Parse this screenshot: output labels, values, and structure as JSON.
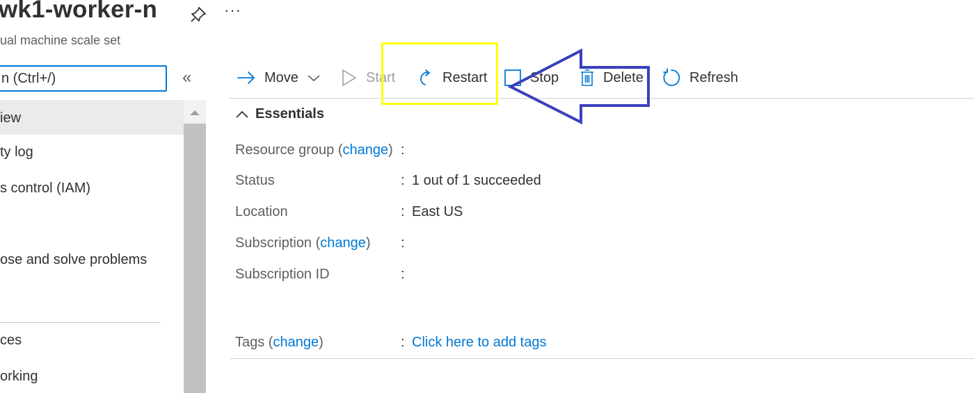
{
  "header": {
    "title": "wk1-worker-n",
    "subtitle": "ual machine scale set",
    "more_label": "···"
  },
  "search": {
    "value": "n (Ctrl+/)"
  },
  "sidebar": {
    "collapse_label": "«",
    "items": [
      {
        "label": "iew",
        "active": true
      },
      {
        "label": "ty log"
      },
      {
        "label": "s control (IAM)"
      },
      {
        "label": "ose and solve problems"
      },
      {
        "label": "ces"
      },
      {
        "label": "orking"
      }
    ]
  },
  "toolbar": {
    "move_label": "Move",
    "start_label": "Start",
    "restart_label": "Restart",
    "stop_label": "Stop",
    "delete_label": "Delete",
    "refresh_label": "Refresh"
  },
  "essentials": {
    "heading": "Essentials",
    "rows": [
      {
        "label": "Resource group",
        "change": "change",
        "value": ""
      },
      {
        "label": "Status",
        "value": "1 out of 1 succeeded"
      },
      {
        "label": "Location",
        "value": "East US"
      },
      {
        "label": "Subscription",
        "change": "change",
        "value": ""
      },
      {
        "label": "Subscription ID",
        "value": ""
      }
    ],
    "tags": {
      "label": "Tags",
      "change": "change",
      "value": "Click here to add tags"
    }
  },
  "annotations": {
    "highlight_color": "#ffff00",
    "arrow_color": "#3b3fbd"
  }
}
